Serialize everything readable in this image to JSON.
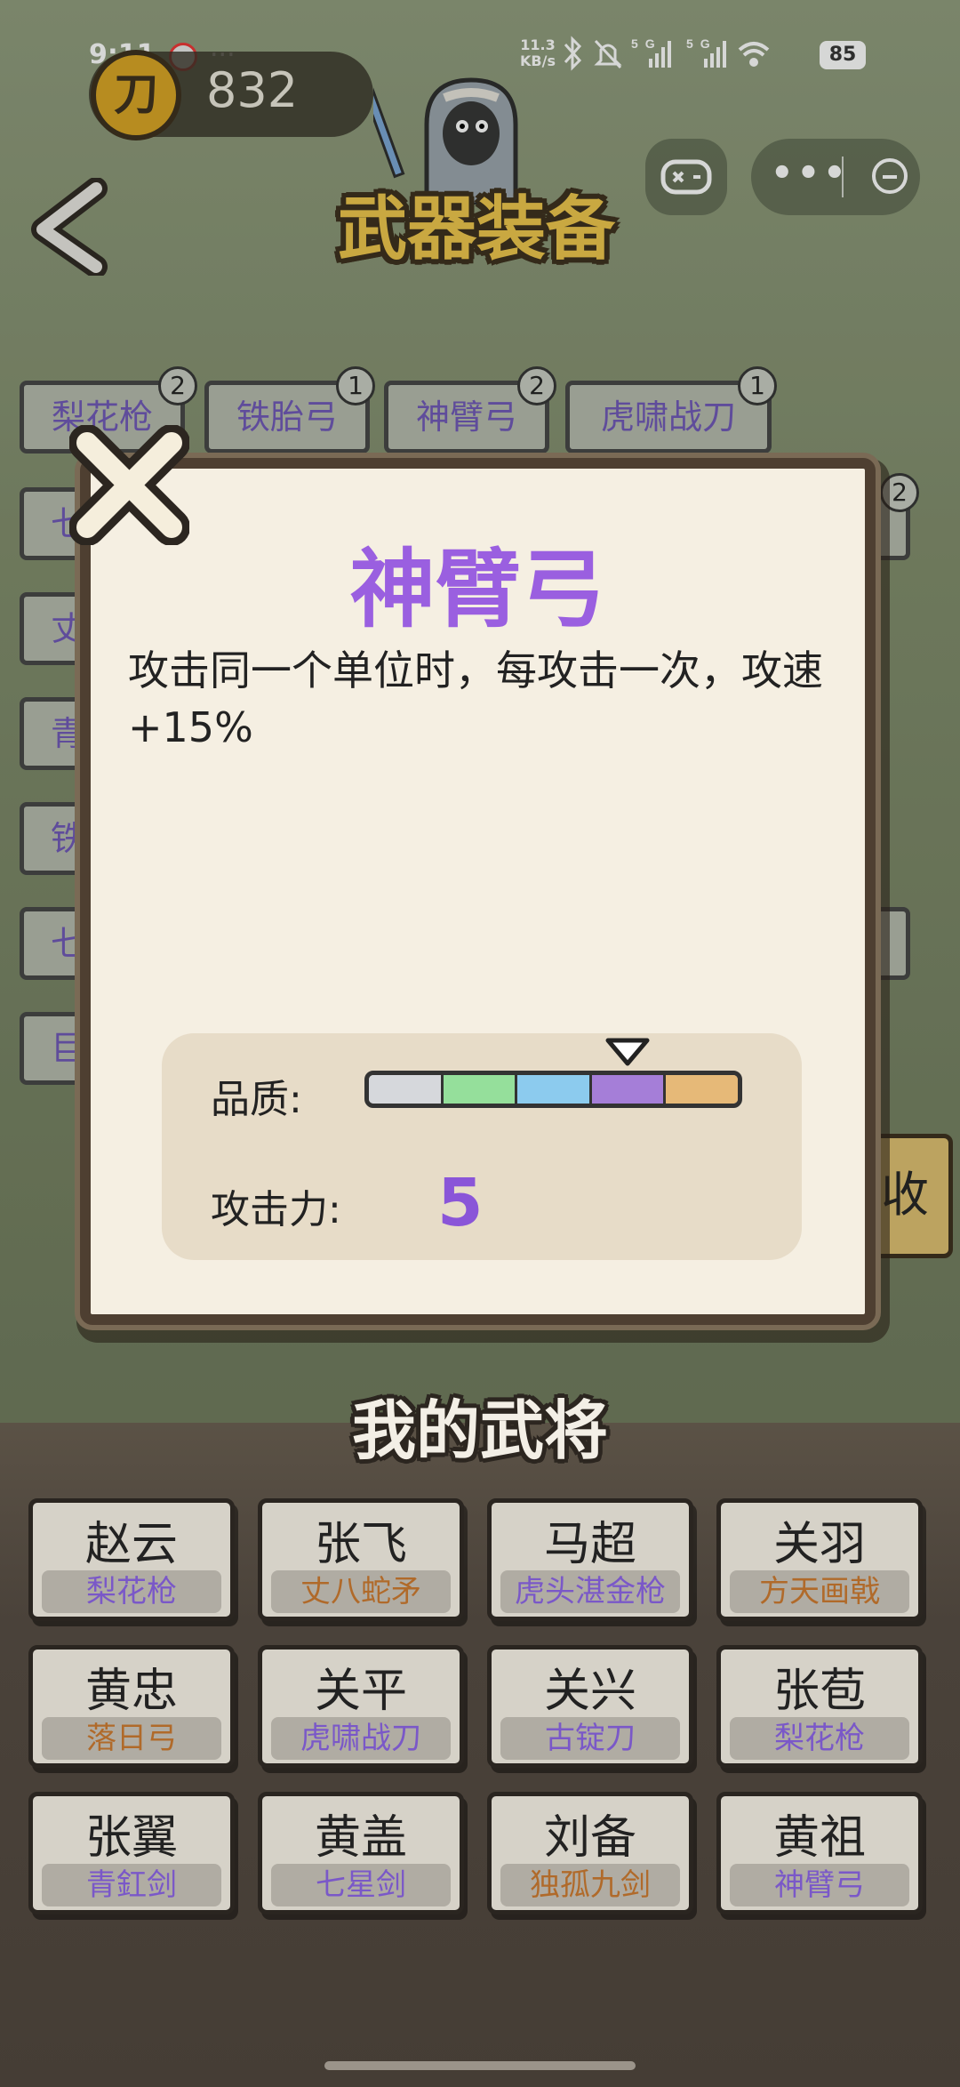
{
  "status_bar": {
    "time": "9:11",
    "dots": "...",
    "speed_top": "11.3",
    "speed_unit": "KB/s",
    "battery": "85"
  },
  "coins": {
    "icon_char": "刀",
    "count": "832"
  },
  "header": {
    "title": "武器装备"
  },
  "weapon_tags": [
    {
      "label": "梨花枪",
      "count": "2"
    },
    {
      "label": "铁胎弓",
      "count": "1"
    },
    {
      "label": "神臂弓",
      "count": "2"
    },
    {
      "label": "虎啸战刀",
      "count": "1"
    }
  ],
  "left_partial_tags": [
    "七",
    "丈",
    "青",
    "铁",
    "七",
    "巨"
  ],
  "right_partial_badge": "2",
  "side_button_label": "收",
  "modal": {
    "title": "神臂弓",
    "description": "攻击同一个单位时，每攻击一次，攻速+15%",
    "quality_label": "品质:",
    "attack_label": "攻击力:",
    "attack_value": "5",
    "quality_level": 4,
    "quality_colors": [
      "#d6d8dc",
      "#95df9b",
      "#8ccbee",
      "#a57ed8",
      "#e6b978"
    ]
  },
  "generals_title": "我的武将",
  "generals": [
    {
      "name": "赵云",
      "weapon": "梨花枪",
      "color": "#7a58c8"
    },
    {
      "name": "张飞",
      "weapon": "丈八蛇矛",
      "color": "#b06a2a"
    },
    {
      "name": "马超",
      "weapon": "虎头湛金枪",
      "color": "#7a58c8"
    },
    {
      "name": "关羽",
      "weapon": "方天画戟",
      "color": "#b06a2a"
    },
    {
      "name": "黄忠",
      "weapon": "落日弓",
      "color": "#b06a2a"
    },
    {
      "name": "关平",
      "weapon": "虎啸战刀",
      "color": "#7a58c8"
    },
    {
      "name": "关兴",
      "weapon": "古锭刀",
      "color": "#7a58c8"
    },
    {
      "name": "张苞",
      "weapon": "梨花枪",
      "color": "#7a58c8"
    },
    {
      "name": "张翼",
      "weapon": "青釭剑",
      "color": "#7a58c8"
    },
    {
      "name": "黄盖",
      "weapon": "七星剑",
      "color": "#7a58c8"
    },
    {
      "name": "刘备",
      "weapon": "独孤九剑",
      "color": "#b06a2a"
    },
    {
      "name": "黄祖",
      "weapon": "神臂弓",
      "color": "#7a58c8"
    }
  ]
}
